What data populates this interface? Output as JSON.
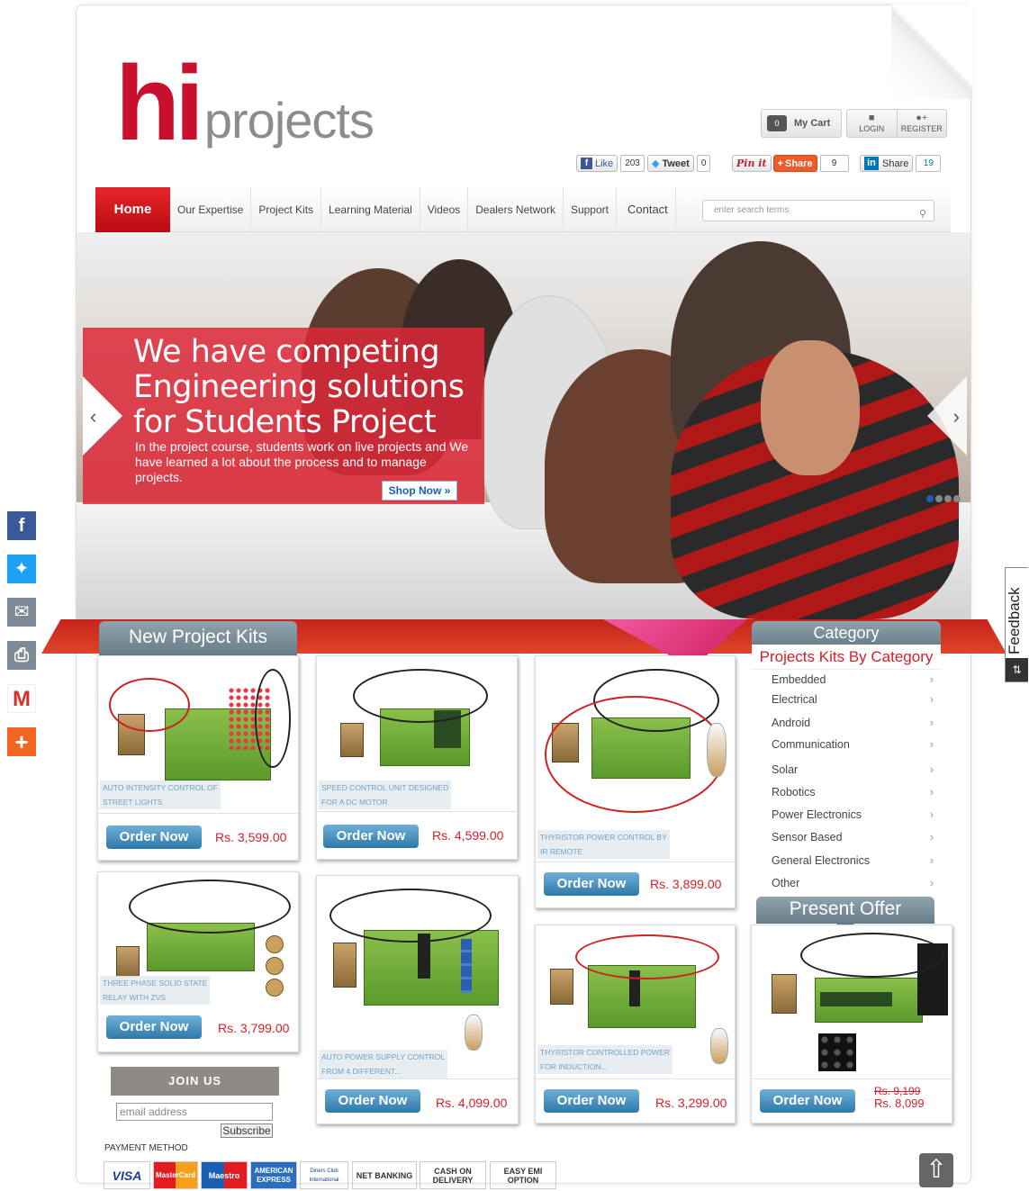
{
  "logo": {
    "hi": "hi",
    "projects": "projects"
  },
  "header": {
    "cart_label": "My Cart",
    "cart_count": "0",
    "login": "LOGIN",
    "register": "REGISTER"
  },
  "share": {
    "like": "Like",
    "like_count": "203",
    "tweet": "Tweet",
    "tweet_count": "0",
    "pinit": "Pin it",
    "share": "Share",
    "share_count": "9",
    "in_share": "Share",
    "in_count": "19"
  },
  "nav": {
    "items": [
      "Home",
      "Our Expertise",
      "Project Kits",
      "Learning Material",
      "Videos",
      "Dealers Network",
      "Support",
      "Contact"
    ],
    "search_placeholder": "enter search terms"
  },
  "hero": {
    "headline": "We have competing Engineering solutions for Students Project",
    "body": "In the project course, students work on live projects and  We have learned a lot about the process and to manage projects.",
    "cta": "Shop Now »"
  },
  "sections": {
    "new_kits": "New Project Kits",
    "category": "Category",
    "category_sub": "Projects Kits By Category",
    "offer": "Present Offer"
  },
  "products": [
    {
      "caption1": "AUTO INTENSITY CONTROL OF",
      "caption2": "STREET LIGHTS",
      "order": "Order Now",
      "price": "Rs. 3,599.00"
    },
    {
      "caption1": "SPEED CONTROL UNIT DESIGNED",
      "caption2": "FOR A DC MOTOR",
      "order": "Order Now",
      "price": "Rs. 4,599.00"
    },
    {
      "caption1": "THYRISTOR POWER CONTROL BY",
      "caption2": "IR REMOTE",
      "order": "Order Now",
      "price": "Rs. 3,899.00"
    },
    {
      "caption1": "THREE PHASE SOLID STATE",
      "caption2": "RELAY WITH ZVS",
      "order": "Order Now",
      "price": "Rs. 3,799.00"
    },
    {
      "caption1": "AUTO POWER SUPPLY CONTROL",
      "caption2": "FROM 4 DIFFERENT...",
      "order": "Order Now",
      "price": "Rs. 4,099.00"
    },
    {
      "caption1": "THYRISTOR CONTROLLED POWER",
      "caption2": "FOR INDUCTION...",
      "order": "Order Now",
      "price": "Rs. 3,299.00"
    }
  ],
  "offer": {
    "order": "Order Now",
    "old_price": "Rs. 9,199",
    "price": "Rs. 8,099"
  },
  "categories": [
    "Embedded",
    "Electrical",
    "Android",
    "Communication",
    "Solar",
    "Robotics",
    "Power Electronics",
    "Sensor Based",
    "General Electronics",
    "Other"
  ],
  "join": {
    "title": "JOIN US",
    "placeholder": "email address",
    "subscribe": "Subscribe"
  },
  "payment": {
    "title": "PAYMENT METHOD",
    "methods": [
      "VISA",
      "MasterCard",
      "Maestro",
      "AMERICAN EXPRESS",
      "Diners Club International",
      "NET BANKING",
      "CASH ON DELIVERY",
      "EASY EMI OPTION"
    ]
  },
  "feedback": "Feedback",
  "colors": {
    "brand_red": "#c8102e",
    "order_blue": "#2f78a8",
    "price_red": "#d21f2a",
    "tab_grey": "#677d88"
  },
  "icons": [
    "cart-icon",
    "lock-icon",
    "add-user-icon",
    "search-icon",
    "facebook-icon",
    "twitter-icon",
    "email-icon",
    "print-icon",
    "gmail-icon",
    "plus-icon",
    "arrow-up-icon"
  ]
}
